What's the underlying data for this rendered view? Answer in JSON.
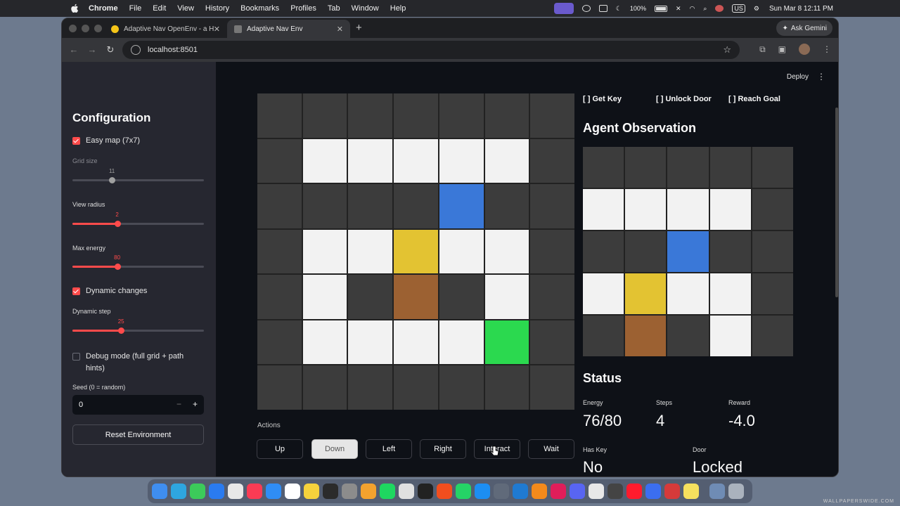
{
  "menubar": {
    "items": [
      "Chrome",
      "File",
      "Edit",
      "View",
      "History",
      "Bookmarks",
      "Profiles",
      "Tab",
      "Window",
      "Help"
    ],
    "battery": "100%",
    "input_source": "US",
    "clock": "Sun Mar 8  12:11 PM"
  },
  "browser": {
    "tabs": [
      {
        "title": "Adaptive Nav OpenEnv - a Hu",
        "favicon_color": "#f5c518"
      },
      {
        "title": "Adaptive Nav Env",
        "favicon_color": "#6a6a6a"
      }
    ],
    "gemini_label": "Ask Gemini",
    "url": "localhost:8501"
  },
  "sidebar": {
    "title": "Configuration",
    "easy_map": {
      "label": "Easy map (7x7)",
      "checked": true
    },
    "grid_size": {
      "label": "Grid size",
      "value": "11",
      "fraction": 0.3,
      "disabled": true
    },
    "view_radius": {
      "label": "View radius",
      "value": "2",
      "fraction": 0.34
    },
    "max_energy": {
      "label": "Max energy",
      "value": "80",
      "fraction": 0.34
    },
    "dynamic_changes": {
      "label": "Dynamic changes",
      "checked": true
    },
    "dynamic_step": {
      "label": "Dynamic step",
      "value": "25",
      "fraction": 0.37
    },
    "debug_mode": {
      "label_line1": "Debug mode (full grid + path",
      "label_line2": "hints)",
      "checked": false
    },
    "seed": {
      "label": "Seed (0 = random)",
      "value": "0",
      "minus": "−",
      "plus": "+"
    },
    "reset_label": "Reset Environment"
  },
  "main": {
    "deploy_label": "Deploy",
    "grid": [
      [
        "wall",
        "wall",
        "wall",
        "wall",
        "wall",
        "wall",
        "wall"
      ],
      [
        "wall",
        "floor",
        "floor",
        "floor",
        "floor",
        "floor",
        "wall"
      ],
      [
        "wall",
        "wall",
        "wall",
        "wall",
        "agent",
        "wall",
        "wall"
      ],
      [
        "wall",
        "floor",
        "floor",
        "key",
        "floor",
        "floor",
        "wall"
      ],
      [
        "wall",
        "floor",
        "wall",
        "door",
        "wall",
        "floor",
        "wall"
      ],
      [
        "wall",
        "floor",
        "floor",
        "floor",
        "floor",
        "goal",
        "wall"
      ],
      [
        "wall",
        "wall",
        "wall",
        "wall",
        "wall",
        "wall",
        "wall"
      ]
    ],
    "goals": [
      "[ ] Get Key",
      "[ ] Unlock Door",
      "[ ] Reach Goal"
    ],
    "observation_title": "Agent Observation",
    "observation": [
      [
        "wall",
        "wall",
        "wall",
        "wall",
        "wall"
      ],
      [
        "floor",
        "floor",
        "floor",
        "floor",
        "wall"
      ],
      [
        "wall",
        "wall",
        "agent",
        "wall",
        "wall"
      ],
      [
        "floor",
        "key",
        "floor",
        "floor",
        "wall"
      ],
      [
        "wall",
        "door",
        "wall",
        "floor",
        "wall"
      ]
    ],
    "actions_label": "Actions",
    "actions": [
      "Up",
      "Down",
      "Left",
      "Right",
      "Interact",
      "Wait"
    ],
    "status_title": "Status",
    "stats": {
      "energy": {
        "label": "Energy",
        "value": "76/80"
      },
      "steps": {
        "label": "Steps",
        "value": "4"
      },
      "reward": {
        "label": "Reward",
        "value": "-4.0"
      },
      "has_key": {
        "label": "Has Key",
        "value": "No"
      },
      "door": {
        "label": "Door",
        "value": "Locked"
      }
    }
  },
  "colors": {
    "accent": "#ff4b4b",
    "agent": "#3a78d8",
    "key": "#e3c332",
    "door": "#9c6132",
    "goal": "#2bd94f",
    "floor": "#f2f2f2",
    "wall": "#3c3c3c"
  },
  "dock": {
    "icons": [
      "finder-icon",
      "telegram-icon",
      "messages-icon",
      "app-store-icon",
      "launchpad-icon",
      "music-icon",
      "safari-icon",
      "calendar-icon",
      "notes-icon",
      "terminal-icon",
      "settings-icon",
      "pages-icon",
      "spotify-icon",
      "screenshot-icon",
      "claquette-icon",
      "figma-icon",
      "whatsapp-icon",
      "xcode-icon",
      "network-icon",
      "vscode-icon",
      "vlc-icon",
      "slack-icon",
      "discord-icon",
      "chrome-icon",
      "cursor-icon",
      "opera-icon",
      "keynote-icon",
      "parallels-icon",
      "stickies-icon",
      "folder-icon",
      "trash-icon"
    ],
    "watermark": "WALLPAPERSWIDE.COM"
  }
}
